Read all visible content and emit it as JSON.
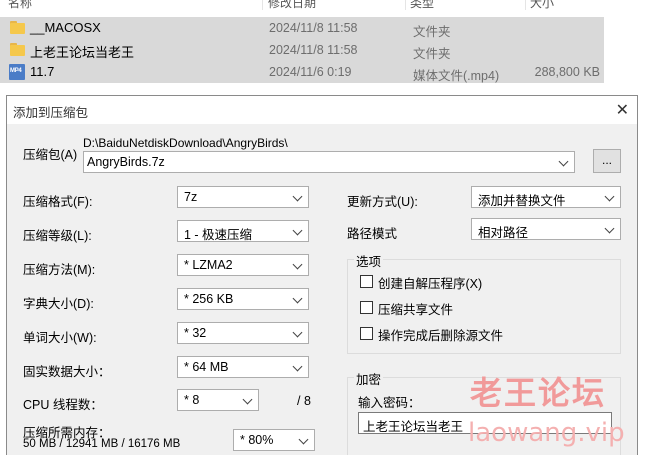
{
  "explorer": {
    "columns": [
      "名称",
      "修改日期",
      "类型",
      "大小"
    ],
    "rows": [
      {
        "icon": "folder-icon",
        "name": "__MACOSX",
        "date": "2024/11/8 11:58",
        "type": "文件夹",
        "size": ""
      },
      {
        "icon": "folder-icon",
        "name": "上老王论坛当老王",
        "date": "2024/11/8 11:58",
        "type": "文件夹",
        "size": ""
      },
      {
        "icon": "mp4-file-icon",
        "name": "11.7",
        "date": "2024/11/6 0:19",
        "type": "媒体文件(.mp4)",
        "size": "288,800 KB"
      }
    ],
    "mp4_badge": "MP4"
  },
  "dialog": {
    "title": "添加到压缩包",
    "close": "✕",
    "archive": {
      "label": "压缩包(A)",
      "path": "D:\\BaiduNetdiskDownload\\AngryBirds\\",
      "name": "AngryBirds.7z",
      "browse": "..."
    },
    "left": {
      "format": {
        "label": "压缩格式(F):",
        "value": "7z"
      },
      "level": {
        "label": "压缩等级(L):",
        "value": "1 - 极速压缩"
      },
      "method": {
        "label": "压缩方法(M):",
        "value": "* LZMA2"
      },
      "dict": {
        "label": "字典大小(D):",
        "value": "* 256 KB"
      },
      "word": {
        "label": "单词大小(W):",
        "value": "* 32"
      },
      "solid": {
        "label": "固实数据大小：",
        "value": "* 64 MB"
      },
      "threads": {
        "label": "CPU 线程数：",
        "value": "* 8",
        "max": "/ 8"
      },
      "memory": {
        "label": "压缩所需内存：",
        "detail": "50 MB / 12941 MB / 16176 MB",
        "value": "* 80%"
      }
    },
    "right": {
      "update": {
        "label": "更新方式(U):",
        "value": "添加并替换文件"
      },
      "pathmode": {
        "label": "路径模式",
        "value": "相对路径"
      },
      "options": {
        "title": "选项",
        "items": [
          "创建自解压程序(X)",
          "压缩共享文件",
          "操作完成后删除源文件"
        ]
      },
      "encrypt": {
        "title": "加密",
        "pw_label": "输入密码：",
        "pw_value": "上老王论坛当老王"
      }
    }
  },
  "watermark": {
    "cn": "老王论坛",
    "url": "laowang.vip"
  }
}
